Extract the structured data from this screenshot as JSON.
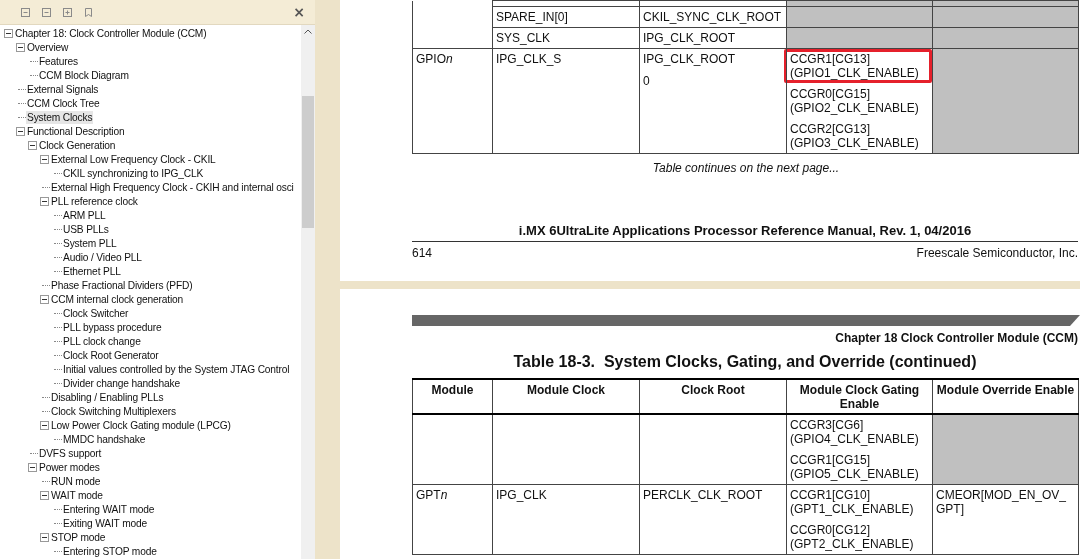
{
  "bookmarks": {
    "close": "×",
    "tree": [
      {
        "label": "Chapter 18: Clock Controller Module (CCM)",
        "selected": false,
        "expanded": true,
        "children": [
          {
            "label": "Overview",
            "selected": false,
            "expanded": true,
            "children": [
              {
                "label": "Features",
                "selected": false
              },
              {
                "label": "CCM Block Diagram",
                "selected": false
              }
            ]
          },
          {
            "label": "External Signals",
            "selected": false
          },
          {
            "label": "CCM Clock Tree",
            "selected": false
          },
          {
            "label": "System Clocks",
            "selected": true
          },
          {
            "label": "Functional Description",
            "selected": false,
            "expanded": true,
            "children": [
              {
                "label": "Clock Generation",
                "selected": false,
                "expanded": true,
                "children": [
                  {
                    "label": "External Low Frequency Clock - CKIL",
                    "selected": false,
                    "expanded": true,
                    "children": [
                      {
                        "label": "CKIL synchronizing to IPG_CLK",
                        "selected": false
                      }
                    ]
                  },
                  {
                    "label": "External High Frequency Clock - CKIH and internal osci",
                    "selected": false
                  },
                  {
                    "label": "PLL reference clock",
                    "selected": false,
                    "expanded": true,
                    "children": [
                      {
                        "label": "ARM PLL",
                        "selected": false
                      },
                      {
                        "label": "USB PLLs",
                        "selected": false
                      },
                      {
                        "label": "System PLL",
                        "selected": false
                      },
                      {
                        "label": "Audio / Video PLL",
                        "selected": false
                      },
                      {
                        "label": "Ethernet PLL",
                        "selected": false
                      }
                    ]
                  },
                  {
                    "label": "Phase Fractional Dividers (PFD)",
                    "selected": false
                  },
                  {
                    "label": "CCM internal clock generation",
                    "selected": false,
                    "expanded": true,
                    "children": [
                      {
                        "label": "Clock Switcher",
                        "selected": false
                      },
                      {
                        "label": "PLL bypass procedure",
                        "selected": false
                      },
                      {
                        "label": "PLL clock change",
                        "selected": false
                      },
                      {
                        "label": "Clock Root Generator",
                        "selected": false
                      },
                      {
                        "label": "Initial values controlled by the System JTAG Control",
                        "selected": false
                      },
                      {
                        "label": "Divider change handshake",
                        "selected": false
                      }
                    ]
                  },
                  {
                    "label": "Disabling / Enabling PLLs",
                    "selected": false
                  },
                  {
                    "label": "Clock Switching Multiplexers",
                    "selected": false
                  },
                  {
                    "label": "Low Power Clock Gating module (LPCG)",
                    "selected": false,
                    "expanded": true,
                    "children": [
                      {
                        "label": "MMDC handshake",
                        "selected": false
                      }
                    ]
                  }
                ]
              },
              {
                "label": "DVFS support",
                "selected": false
              },
              {
                "label": "Power modes",
                "selected": false,
                "expanded": true,
                "children": [
                  {
                    "label": "RUN mode",
                    "selected": false
                  },
                  {
                    "label": "WAIT mode",
                    "selected": false,
                    "expanded": true,
                    "children": [
                      {
                        "label": "Entering WAIT mode",
                        "selected": false
                      },
                      {
                        "label": "Exiting WAIT mode",
                        "selected": false
                      }
                    ]
                  },
                  {
                    "label": "STOP mode",
                    "selected": false,
                    "expanded": true,
                    "children": [
                      {
                        "label": "Entering STOP mode",
                        "selected": false
                      }
                    ]
                  }
                ]
              }
            ]
          }
        ]
      }
    ]
  },
  "pages": [
    {
      "kind": "continued",
      "groups": [
        {
          "entries": [
            {
              "gating_shaded": true,
              "override_shaded": true
            },
            {
              "module_clock": "SPARE_IN[0]",
              "clock_root": [
                "CKIL_SYNC_CLK_ROOT"
              ],
              "gating_shaded": true,
              "override_shaded": true
            },
            {
              "module_clock": "SYS_CLK",
              "clock_root": [
                "IPG_CLK_ROOT"
              ],
              "gating_shaded": true,
              "override_shaded": true
            }
          ]
        },
        {
          "module": {
            "text": "GPIO",
            "suffix": "n"
          },
          "entries": [
            {
              "module_clock": "IPG_CLK_S",
              "clock_root": [
                "IPG_CLK_ROOT",
                "0"
              ],
              "gating": [
                {
                  "text": "CCGR1[CG13]\n(GPIO1_CLK_ENABLE)",
                  "highlighted": true
                },
                {
                  "text": "CCGR0[CG15]\n(GPIO2_CLK_ENABLE)",
                  "highlighted": false
                },
                {
                  "text": "CCGR2[CG13]\n(GPIO3_CLK_ENABLE)",
                  "highlighted": false
                }
              ],
              "gating_shaded": false,
              "override_shaded": true
            }
          ]
        }
      ],
      "note": "Table continues on the next page...",
      "footer": {
        "title": "i.MX 6UltraLite Applications Processor Reference Manual, Rev. 1, 04/2016",
        "page_number": "614",
        "publisher": "Freescale Semiconductor, Inc."
      }
    },
    {
      "kind": "start",
      "chapter": "Chapter 18 Clock Controller Module (CCM)",
      "title": "Table 18-3.  System Clocks, Gating, and Override (continued)",
      "columns": [
        "Module",
        "Module Clock",
        "Clock Root",
        "Module Clock Gating Enable",
        "Module Override Enable"
      ],
      "groups": [
        {
          "entries": [
            {
              "gating": [
                {
                  "text": "CCGR3[CG6]\n(GPIO4_CLK_ENABLE)",
                  "highlighted": false
                },
                {
                  "text": "CCGR1[CG15]\n(GPIO5_CLK_ENABLE)",
                  "highlighted": false
                }
              ],
              "gating_shaded": false,
              "override_shaded": true
            }
          ]
        },
        {
          "module": {
            "text": "GPT",
            "suffix": "n"
          },
          "entries": [
            {
              "module_clock": "IPG_CLK",
              "clock_root": [
                "PERCLK_CLK_ROOT"
              ],
              "gating": [
                {
                  "text": "CCGR1[CG10]\n(GPT1_CLK_ENABLE)",
                  "highlighted": false
                },
                {
                  "text": "CCGR0[CG12]\n(GPT2_CLK_ENABLE)",
                  "highlighted": false
                }
              ],
              "gating_shaded": false,
              "override_shaded": false,
              "override": "CMEOR[MOD_EN_OV_GPT]"
            }
          ]
        }
      ]
    }
  ]
}
